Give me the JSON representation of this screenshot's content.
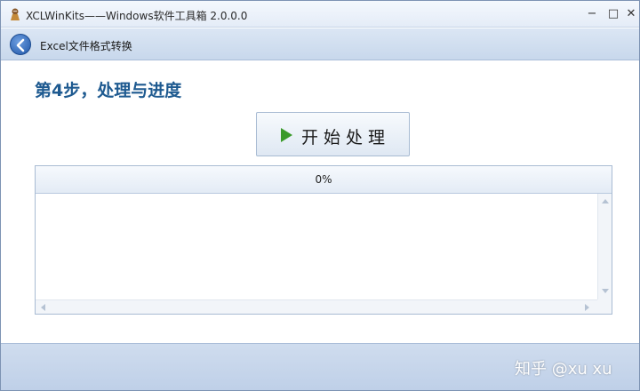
{
  "window": {
    "title": "XCLWinKits——Windows软件工具箱 2.0.0.0",
    "minimize_glyph": "−",
    "maximize_glyph": "□",
    "close_glyph": "✕"
  },
  "nav": {
    "title": "Excel文件格式转换",
    "back_icon": "back-arrow-icon"
  },
  "step": {
    "title": "第4步，处理与进度"
  },
  "start_button": {
    "label": "开始处理",
    "icon": "play-icon",
    "icon_color": "#3a9a2a"
  },
  "progress": {
    "label": "0%",
    "value": 0
  },
  "log": {
    "lines": []
  },
  "footer": {
    "watermark": "知乎 @xu xu"
  },
  "colors": {
    "accent": "#1e5a90",
    "chrome": "#c8d8ec"
  }
}
